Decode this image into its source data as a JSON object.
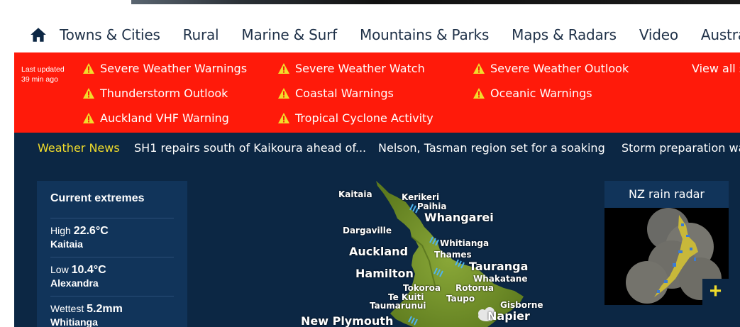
{
  "nav": {
    "items": [
      "Towns & Cities",
      "Rural",
      "Marine & Surf",
      "Mountains & Parks",
      "Maps & Radars",
      "Video",
      "Australia"
    ]
  },
  "warnings": {
    "last_updated": "Last updated",
    "ago": "39 min ago",
    "items": [
      "Severe Weather Warnings",
      "Severe Weather Watch",
      "Severe Weather Outlook",
      "Thunderstorm Outlook",
      "Coastal Warnings",
      "Oceanic Warnings",
      "Auckland VHF Warning",
      "Tropical Cyclone Activity"
    ],
    "view_all": "View all s"
  },
  "news": {
    "label": "Weather News",
    "headlines": [
      "SH1 repairs south of Kaikoura ahead of...",
      "Nelson, Tasman region set for a soaking",
      "Storm preparation wa"
    ]
  },
  "extremes": {
    "title": "Current extremes",
    "rows": [
      {
        "label": "High",
        "value": "22.6°C",
        "place": "Kaitaia"
      },
      {
        "label": "Low",
        "value": "10.4°C",
        "place": "Alexandra"
      },
      {
        "label": "Wettest",
        "value": "5.2mm",
        "place": "Whitianga"
      }
    ]
  },
  "map": {
    "places": [
      "Kaitaia",
      "Kerikeri",
      "Paihia",
      "Whangarei",
      "Dargaville",
      "Whitianga",
      "Auckland",
      "Thames",
      "Tauranga",
      "Hamilton",
      "Whakatane",
      "Tokoroa",
      "Rotorua",
      "Te Kuiti",
      "Taupo",
      "Taumarunui",
      "Gisborne",
      "Napier",
      "New Plymouth"
    ]
  },
  "radar": {
    "title": "NZ rain radar",
    "plus": "+"
  },
  "colors": {
    "nav_text": "#1f3148",
    "warning_bg": "#ff1a0a",
    "dark_bg": "#0c2744",
    "panel_bg": "#11345a",
    "accent_yellow": "#f1dc2b"
  }
}
